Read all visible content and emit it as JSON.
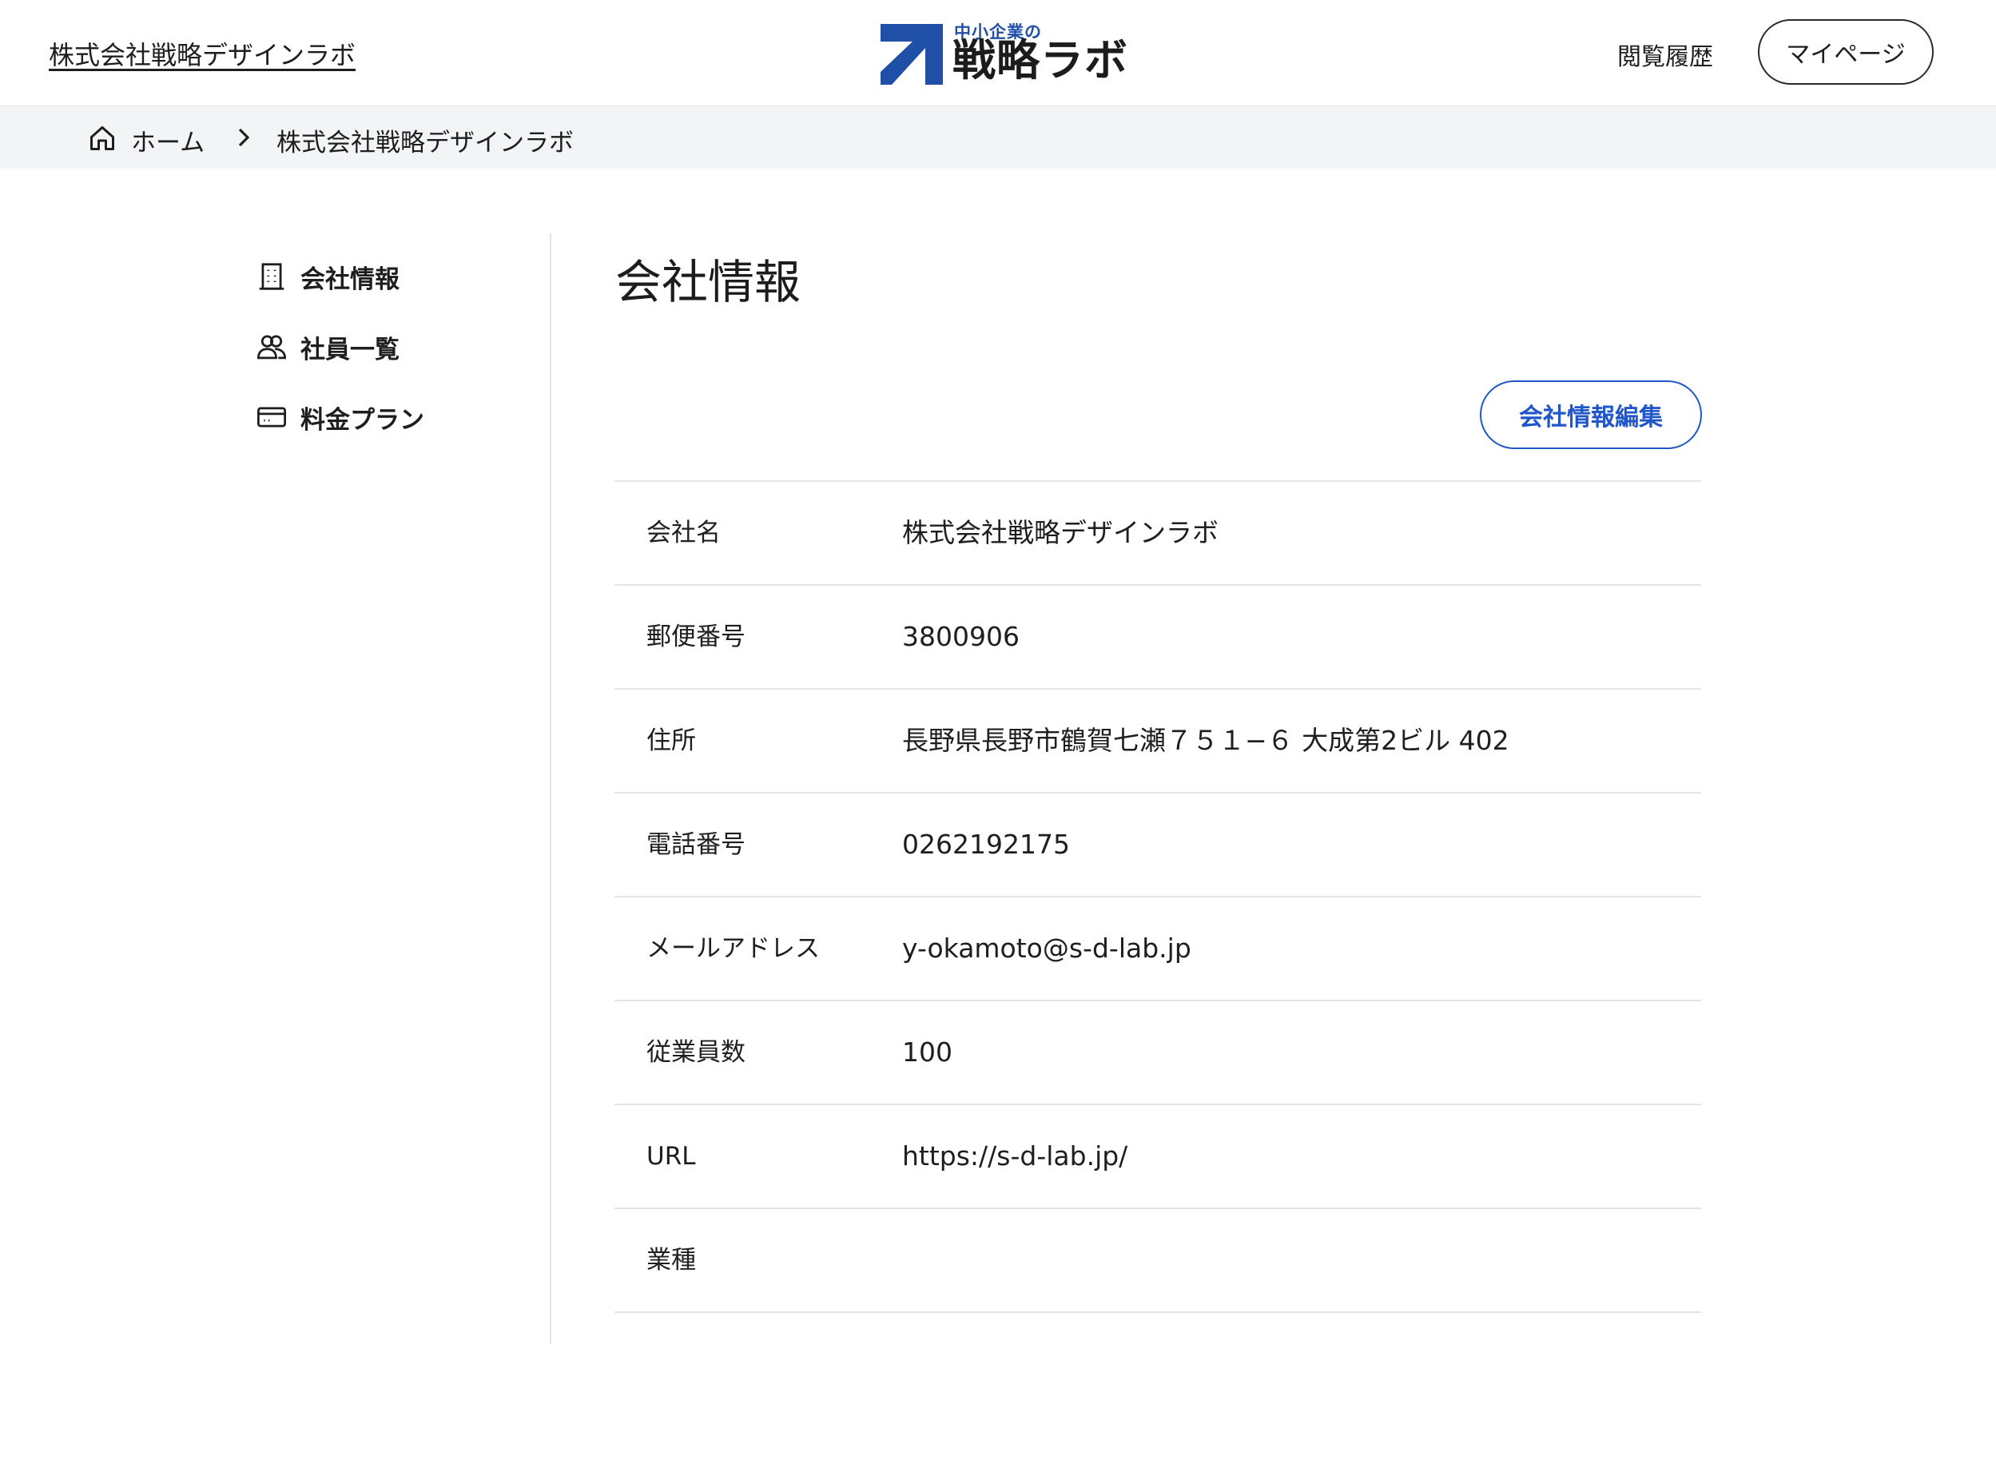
{
  "header": {
    "company_name": "株式会社戦略デザインラボ",
    "logo_sub": "中小企業の",
    "logo_main": "戦略ラボ",
    "history_label": "閲覧履歴",
    "mypage_label": "マイページ"
  },
  "breadcrumb": {
    "home": "ホーム",
    "current": "株式会社戦略デザインラボ"
  },
  "sidebar": {
    "items": [
      {
        "label": "会社情報",
        "icon": "building-icon"
      },
      {
        "label": "社員一覧",
        "icon": "users-icon"
      },
      {
        "label": "料金プラン",
        "icon": "credit-card-icon"
      }
    ]
  },
  "main": {
    "title": "会社情報",
    "edit_button": "会社情報編集",
    "rows": [
      {
        "label": "会社名",
        "value": "株式会社戦略デザインラボ"
      },
      {
        "label": "郵便番号",
        "value": "3800906"
      },
      {
        "label": "住所",
        "value": "長野県長野市鶴賀七瀬７５１−６ 大成第2ビル 402"
      },
      {
        "label": "電話番号",
        "value": "0262192175"
      },
      {
        "label": "メールアドレス",
        "value": "y-okamoto@s-d-lab.jp"
      },
      {
        "label": "従業員数",
        "value": "100"
      },
      {
        "label": "URL",
        "value": "https://s-d-lab.jp/"
      },
      {
        "label": "業種",
        "value": ""
      }
    ]
  },
  "colors": {
    "accent": "#1f56c9",
    "logo_blue": "#1f4fa6",
    "breadcrumb_bg": "#f3f4f6"
  }
}
